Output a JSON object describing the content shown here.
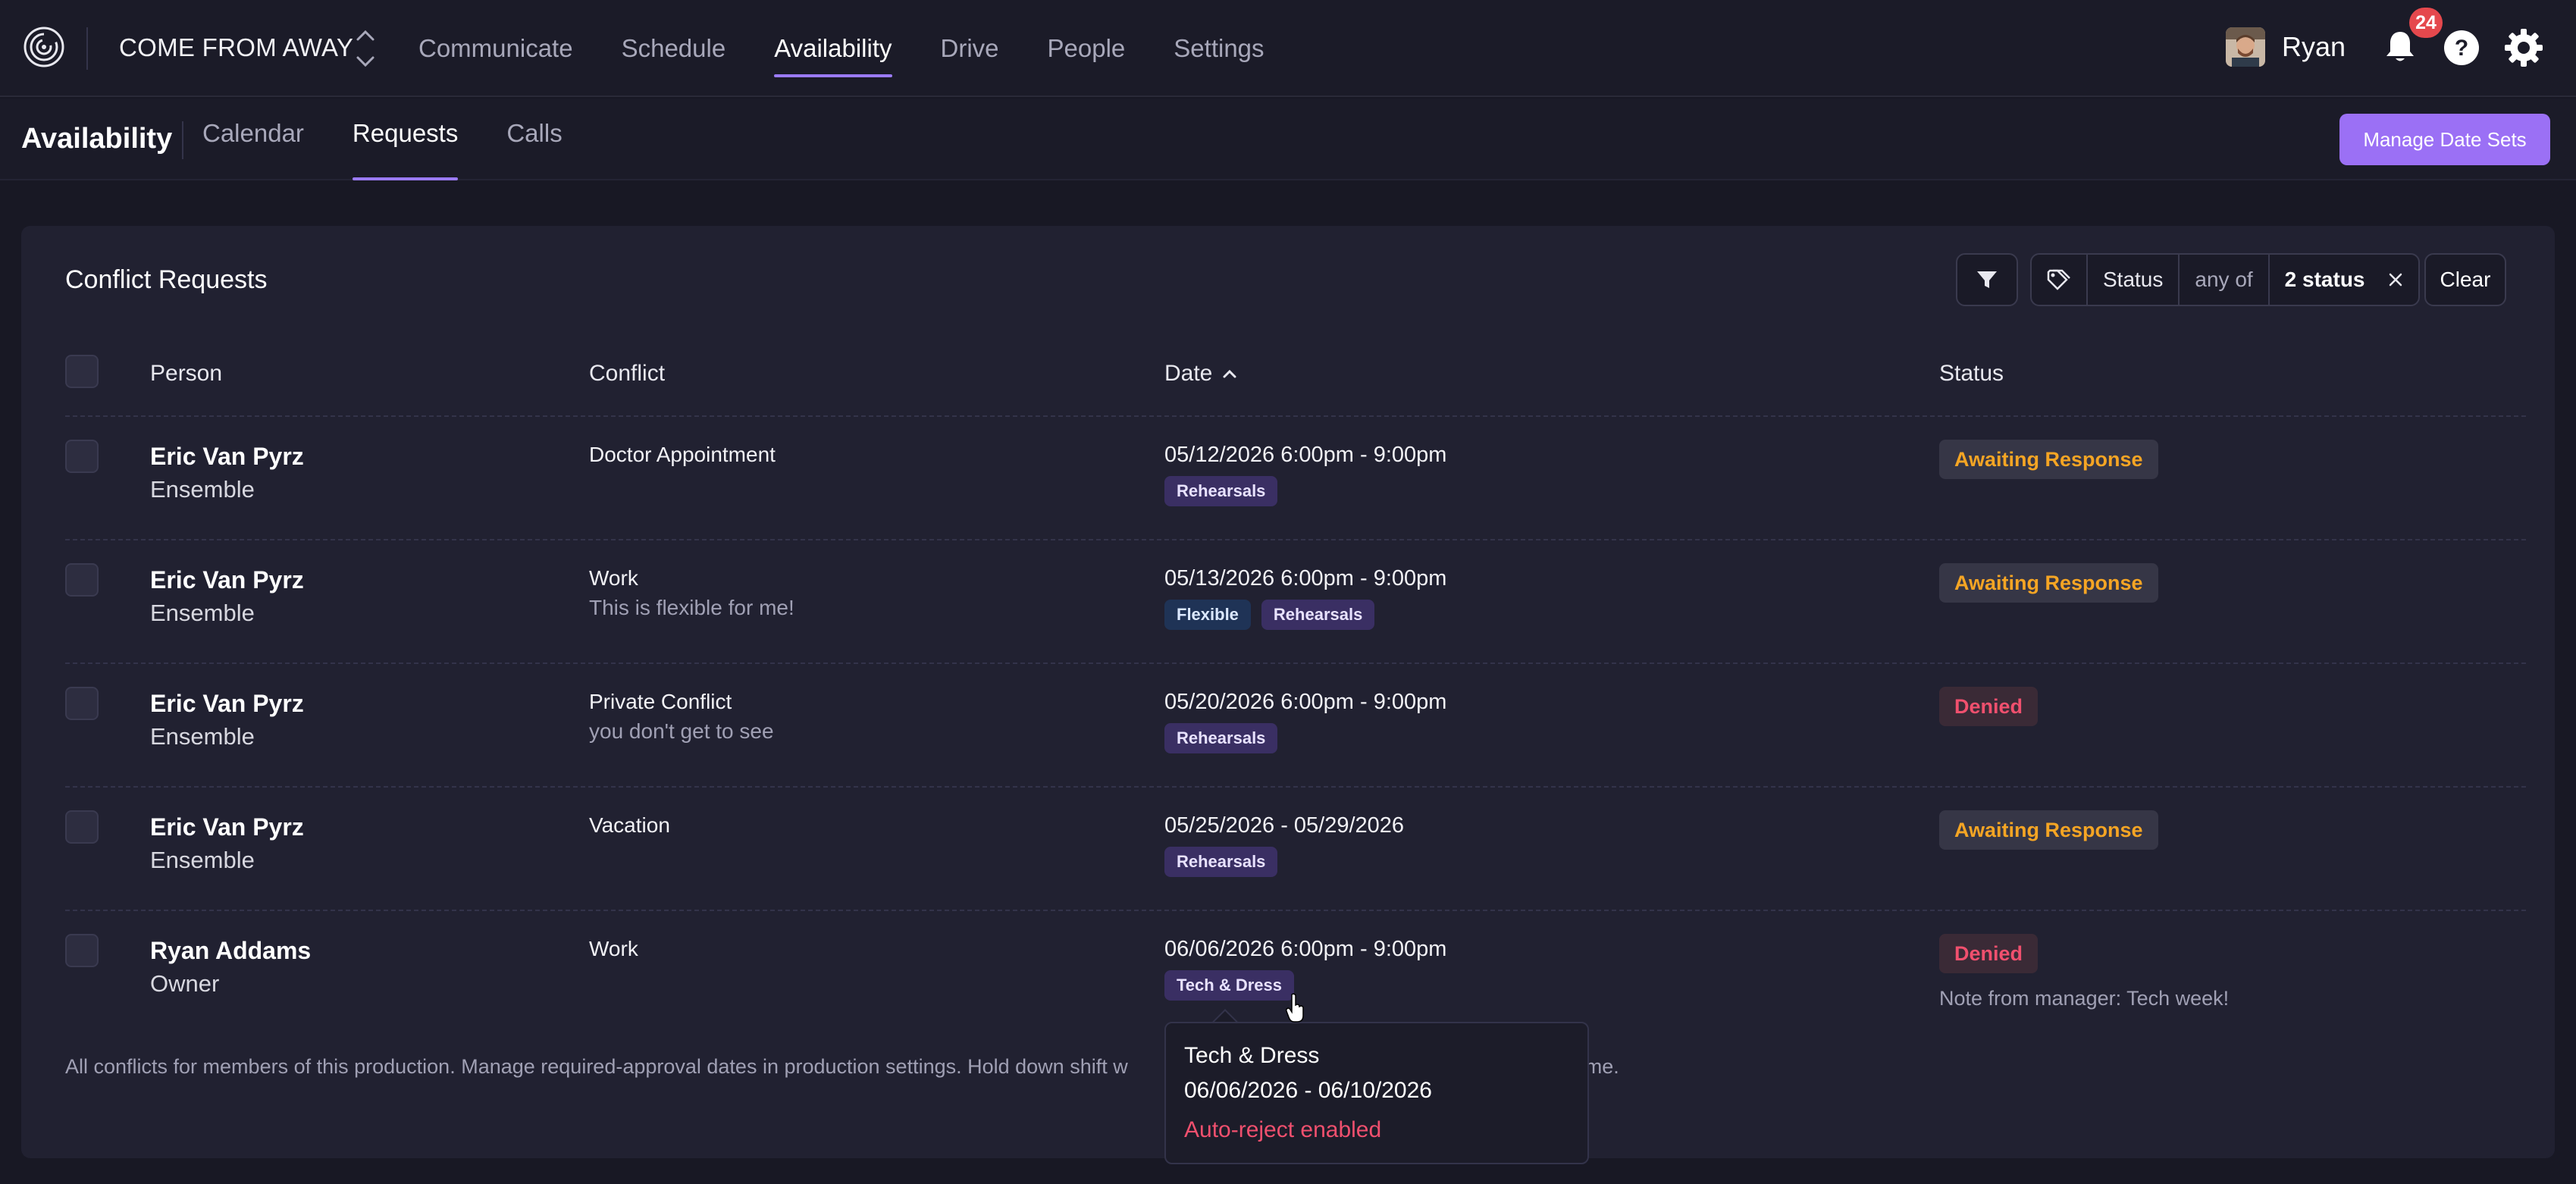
{
  "header": {
    "production_name": "COME FROM AWAY",
    "nav": [
      {
        "label": "Communicate",
        "active": false
      },
      {
        "label": "Schedule",
        "active": false
      },
      {
        "label": "Availability",
        "active": true
      },
      {
        "label": "Drive",
        "active": false
      },
      {
        "label": "People",
        "active": false
      },
      {
        "label": "Settings",
        "active": false
      }
    ],
    "user_name": "Ryan",
    "notification_count": "24",
    "accent_color": "#9b7bf7"
  },
  "subheader": {
    "title": "Availability",
    "tabs": [
      {
        "label": "Calendar",
        "active": false
      },
      {
        "label": "Requests",
        "active": true
      },
      {
        "label": "Calls",
        "active": false
      }
    ],
    "manage_button": "Manage Date Sets"
  },
  "card": {
    "title": "Conflict Requests",
    "filter": {
      "field": "Status",
      "operator": "any of",
      "value": "2 status",
      "clear_label": "Clear"
    },
    "columns": {
      "person": "Person",
      "conflict": "Conflict",
      "date": "Date",
      "status": "Status"
    },
    "rows": [
      {
        "person": "Eric Van Pyrz",
        "role": "Ensemble",
        "conflict": "Doctor Appointment",
        "note": "",
        "date": "05/12/2026 6:00pm - 9:00pm",
        "tags": [
          "Rehearsals"
        ],
        "status": "Awaiting Response",
        "manager_note": ""
      },
      {
        "person": "Eric Van Pyrz",
        "role": "Ensemble",
        "conflict": "Work",
        "note": "This is flexible for me!",
        "date": "05/13/2026 6:00pm - 9:00pm",
        "tags": [
          "Flexible",
          "Rehearsals"
        ],
        "status": "Awaiting Response",
        "manager_note": ""
      },
      {
        "person": "Eric Van Pyrz",
        "role": "Ensemble",
        "conflict": "Private Conflict",
        "note": "you don't get to see",
        "date": "05/20/2026 6:00pm - 9:00pm",
        "tags": [
          "Rehearsals"
        ],
        "status": "Denied",
        "manager_note": ""
      },
      {
        "person": "Eric Van Pyrz",
        "role": "Ensemble",
        "conflict": "Vacation",
        "note": "",
        "date": "05/25/2026 - 05/29/2026",
        "tags": [
          "Rehearsals"
        ],
        "status": "Awaiting Response",
        "manager_note": ""
      },
      {
        "person": "Ryan Addams",
        "role": "Owner",
        "conflict": "Work",
        "note": "",
        "date": "06/06/2026 6:00pm - 9:00pm",
        "tags": [
          "Tech & Dress"
        ],
        "status": "Denied",
        "manager_note": "Note from manager: Tech week!"
      }
    ],
    "footer_left": "All conflicts for members of this production. Manage required-approval dates in production settings. Hold down shift w",
    "footer_right": "t the same time."
  },
  "tooltip": {
    "title": "Tech & Dress",
    "dates": "06/06/2026 - 06/10/2026",
    "warning": "Auto-reject enabled"
  },
  "colors": {
    "awaiting": "#f5a524",
    "denied": "#f0506e",
    "button": "#9b70f5"
  }
}
